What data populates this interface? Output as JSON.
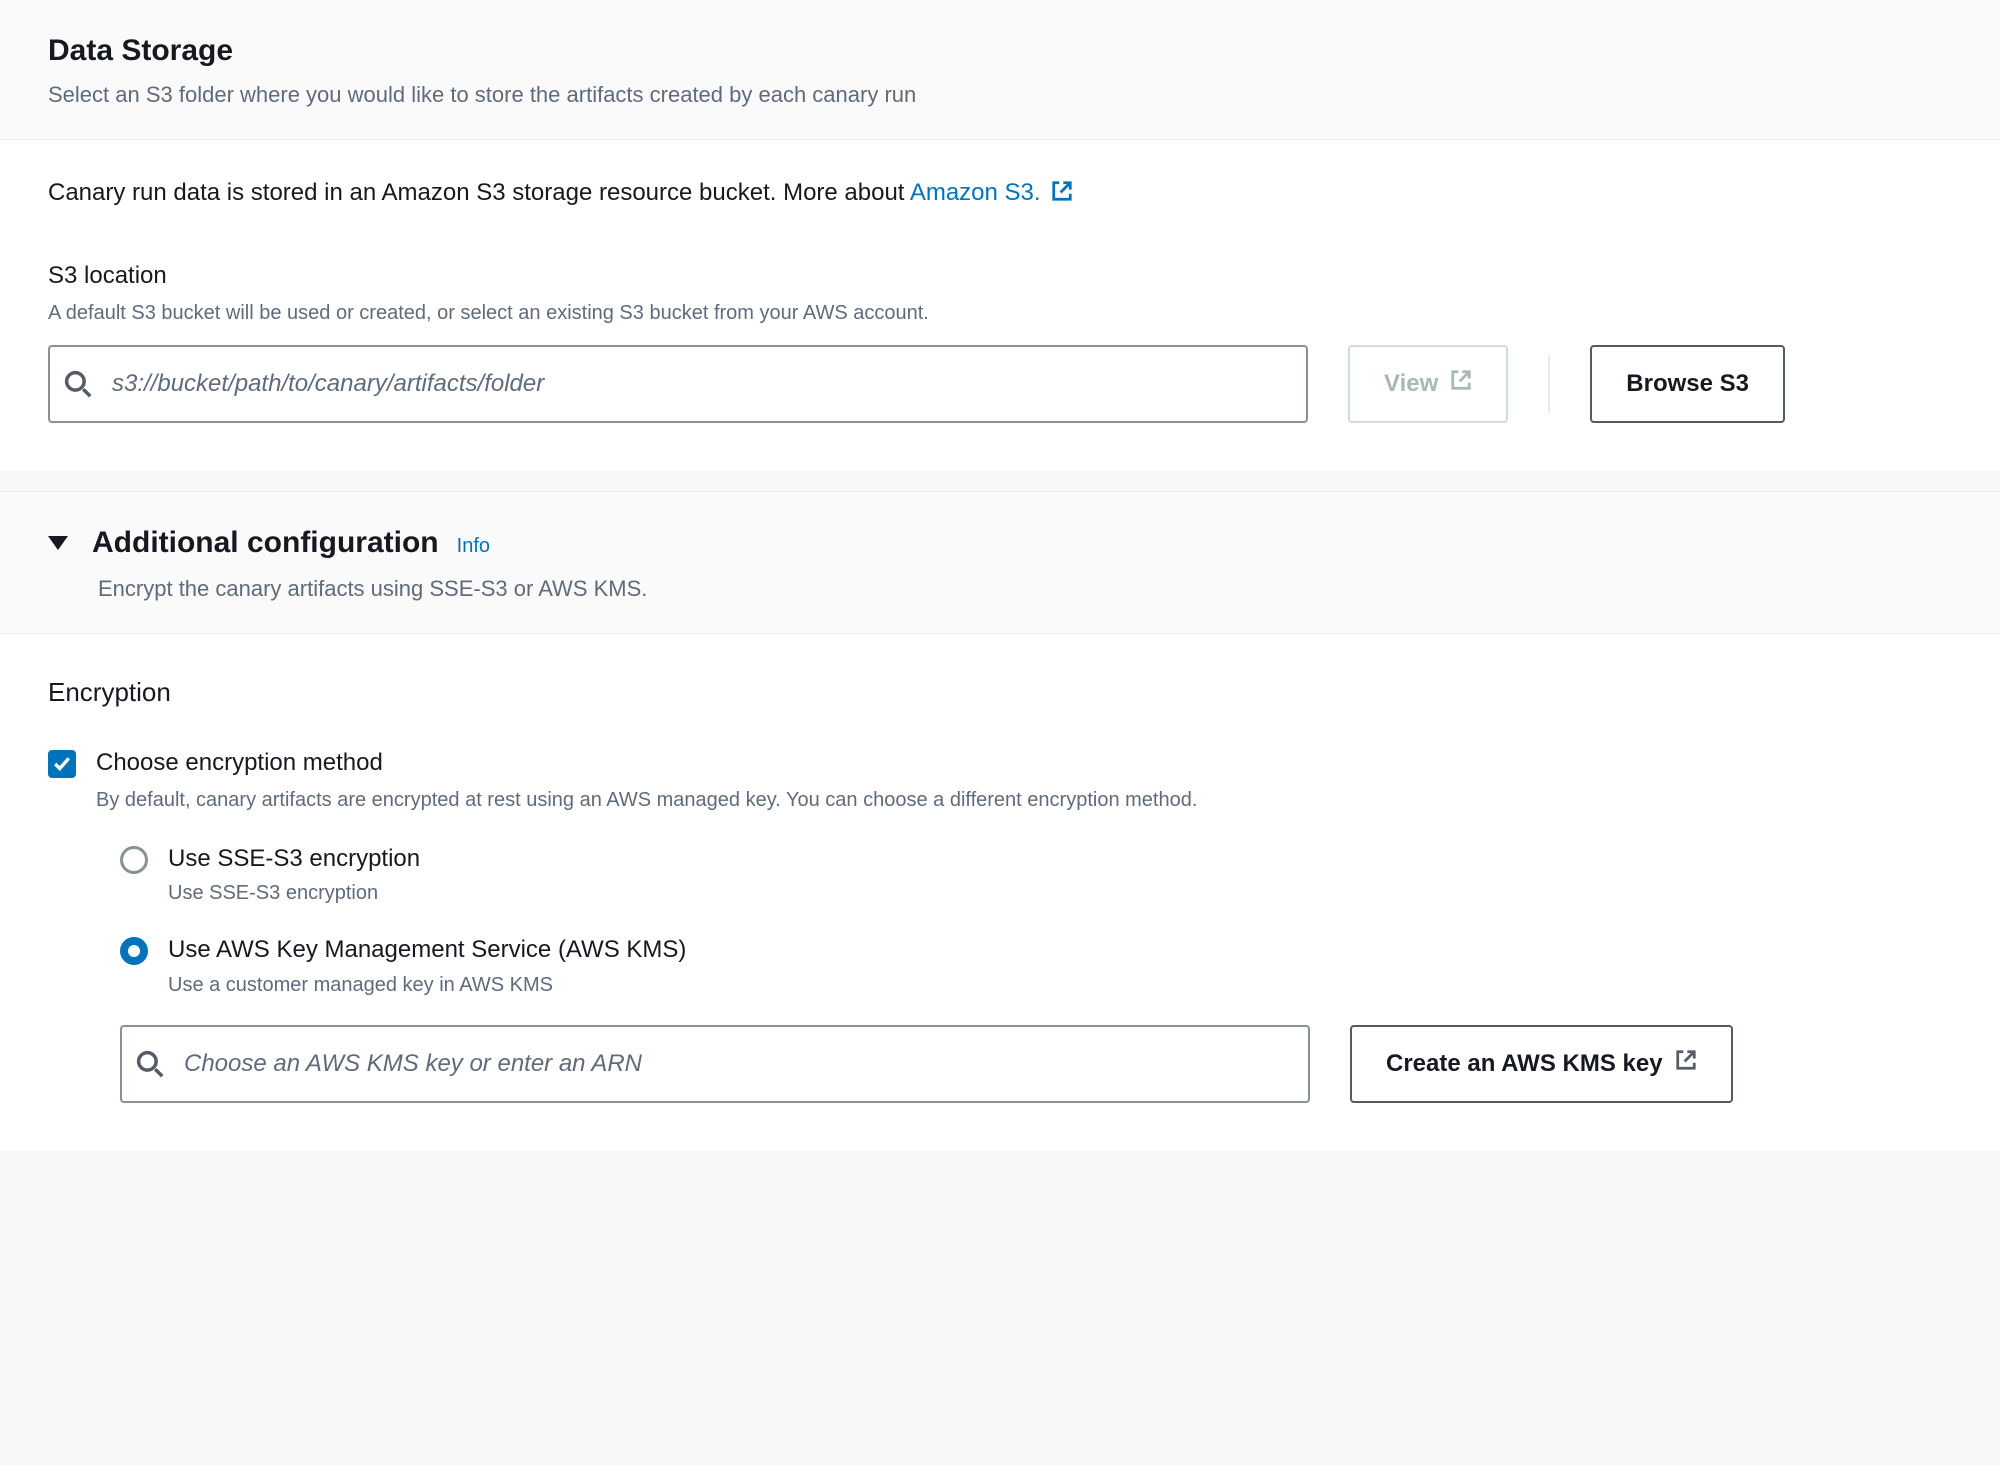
{
  "dataStorage": {
    "title": "Data Storage",
    "subtitle": "Select an S3 folder where you would like to store the artifacts created by each canary run",
    "infoPrefix": "Canary run data is stored in an Amazon S3 storage resource bucket. More about ",
    "infoLinkText": "Amazon S3.",
    "s3": {
      "label": "S3 location",
      "hint": "A default S3 bucket will be used or created, or select an existing S3 bucket from your AWS account.",
      "placeholder": "s3://bucket/path/to/canary/artifacts/folder",
      "viewLabel": "View",
      "browseLabel": "Browse S3"
    }
  },
  "additional": {
    "title": "Additional configuration",
    "infoLink": "Info",
    "subtitle": "Encrypt the canary artifacts using SSE-S3 or AWS KMS."
  },
  "encryption": {
    "heading": "Encryption",
    "checkbox": {
      "label": "Choose encryption method",
      "hint": "By default, canary artifacts are encrypted at rest using an AWS managed key. You can choose a different encryption method."
    },
    "options": {
      "sse": {
        "label": "Use SSE-S3 encryption",
        "hint": "Use SSE-S3 encryption"
      },
      "kms": {
        "label": "Use AWS Key Management Service (AWS KMS)",
        "hint": "Use a customer managed key in AWS KMS"
      }
    },
    "kmsInput": {
      "placeholder": "Choose an AWS KMS key or enter an ARN"
    },
    "createKeyLabel": "Create an AWS KMS key"
  }
}
